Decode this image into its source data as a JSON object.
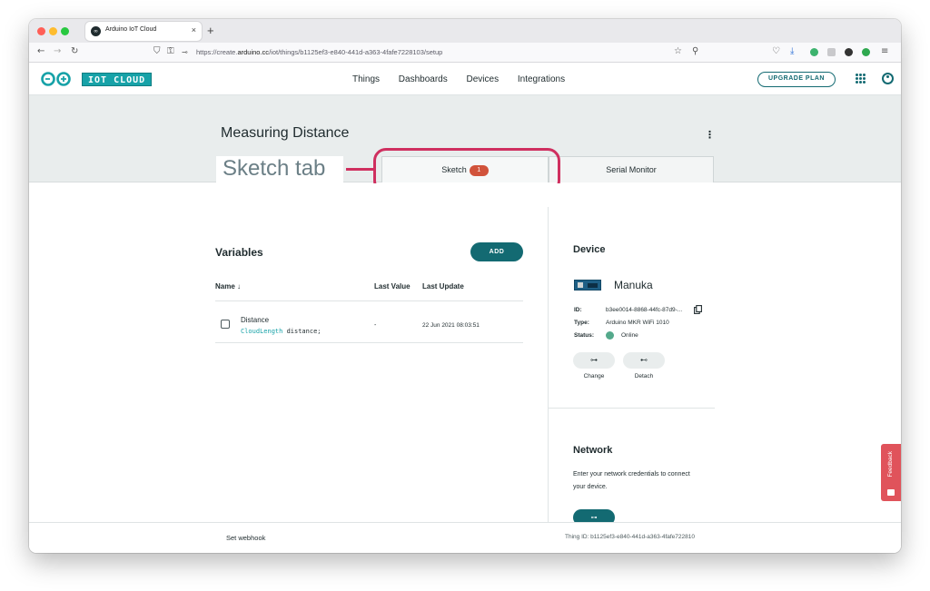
{
  "browser": {
    "tab_title": "Arduino IoT Cloud",
    "tab_close": "×",
    "new_tab": "+",
    "url_prefix": "https://create.",
    "url_domain": "arduino.cc",
    "url_path": "/iot/things/b1125ef3-e840-441d-a363-4fafe7228103/setup",
    "traffic_colors": [
      "#ff5f57",
      "#febc2e",
      "#28c840"
    ]
  },
  "header": {
    "logo_text": "IOT CLOUD",
    "nav": [
      "Things",
      "Dashboards",
      "Devices",
      "Integrations"
    ],
    "upgrade_label": "UPGRADE PLAN",
    "accent": "#136a72"
  },
  "thing": {
    "title": "Measuring Distance",
    "menu_glyph": "⋮",
    "annotation": "Sketch tab",
    "tabs": [
      {
        "label": "Sketch",
        "badge": "1"
      },
      {
        "label": "Serial Monitor"
      }
    ],
    "annotation_color": "#cf2f5f"
  },
  "variables": {
    "title": "Variables",
    "add_label": "ADD",
    "columns": [
      "Name ↓",
      "Last Value",
      "Last Update"
    ],
    "rows": [
      {
        "name": "Distance",
        "type": "CloudLength",
        "decl": " distance;",
        "value": "-",
        "updated": "22 Jun 2021 08:03:51"
      }
    ]
  },
  "device": {
    "title": "Device",
    "name": "Manuka",
    "id_label": "ID:",
    "id_value": "b3ee0014-8868-44fc-87d9-...",
    "type_label": "Type:",
    "type_value": "Arduino MKR WiFi 1010",
    "status_label": "Status:",
    "status_value": "Online",
    "status_color": "#54a98b",
    "change_label": "Change",
    "detach_label": "Detach",
    "change_glyph": "⊶",
    "detach_glyph": "⊷"
  },
  "network": {
    "title": "Network",
    "text": "Enter your network credentials to connect your device.",
    "button_glyph": "⊶"
  },
  "feedback_label": "Feedback",
  "footer": {
    "webhook": "Set webhook",
    "thing_id": "Thing ID: b1125ef3-e840-441d-a363-4fafe722810"
  }
}
